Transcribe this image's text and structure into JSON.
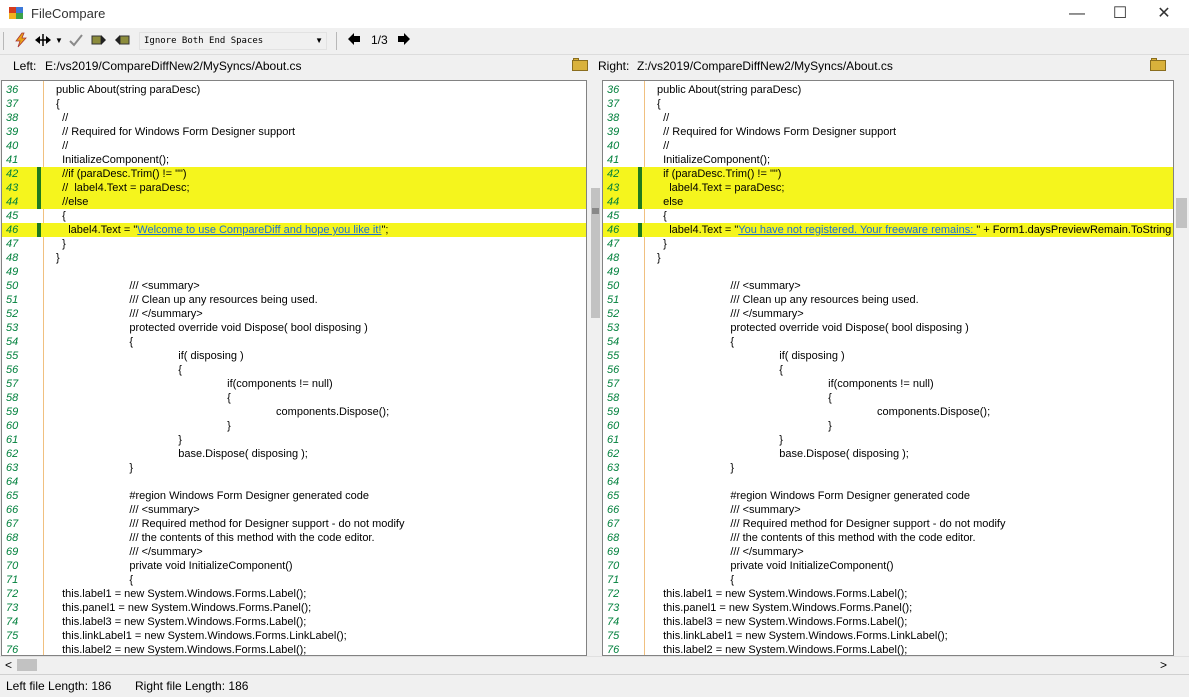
{
  "window": {
    "title": "FileCompare",
    "minimize_glyph": "—",
    "maximize_glyph": "☐",
    "close_glyph": "✕"
  },
  "toolbar": {
    "ignore_option": "Ignore Both End Spaces",
    "page_indicator": "1/3",
    "icons": [
      "lightning-icon",
      "split-arrows-icon",
      "dropdown-arrow-icon",
      "check-icon",
      "copy-right-icon",
      "copy-left-icon",
      "prev-arrow-icon",
      "next-arrow-icon"
    ]
  },
  "left": {
    "label": "Left:",
    "path": "E:/vs2019/CompareDiffNew2/MySyncs/About.cs",
    "lines": [
      {
        "n": "36",
        "t": "public About(string paraDesc)"
      },
      {
        "n": "37",
        "t": "{"
      },
      {
        "n": "38",
        "t": "  //"
      },
      {
        "n": "39",
        "t": "  // Required for Windows Form Designer support"
      },
      {
        "n": "40",
        "t": "  //"
      },
      {
        "n": "41",
        "t": "  InitializeComponent();"
      },
      {
        "n": "42",
        "t": "  //if (paraDesc.Trim() != \"\")"
      },
      {
        "n": "43",
        "t": "  //  label4.Text = paraDesc;"
      },
      {
        "n": "44",
        "t": "  //else"
      },
      {
        "n": "45",
        "t": "  {"
      },
      {
        "n": "46",
        "t": "    label4.Text = \"Welcome to use CompareDiff and hope you like it!\";"
      },
      {
        "n": "47",
        "t": "  }"
      },
      {
        "n": "48",
        "t": "}"
      },
      {
        "n": "49",
        "t": ""
      },
      {
        "n": "50",
        "t": "                        /// <summary>"
      },
      {
        "n": "51",
        "t": "                        /// Clean up any resources being used."
      },
      {
        "n": "52",
        "t": "                        /// </summary>"
      },
      {
        "n": "53",
        "t": "                        protected override void Dispose( bool disposing )"
      },
      {
        "n": "54",
        "t": "                        {"
      },
      {
        "n": "55",
        "t": "                                        if( disposing )"
      },
      {
        "n": "56",
        "t": "                                        {"
      },
      {
        "n": "57",
        "t": "                                                        if(components != null)"
      },
      {
        "n": "58",
        "t": "                                                        {"
      },
      {
        "n": "59",
        "t": "                                                                        components.Dispose();"
      },
      {
        "n": "60",
        "t": "                                                        }"
      },
      {
        "n": "61",
        "t": "                                        }"
      },
      {
        "n": "62",
        "t": "                                        base.Dispose( disposing );"
      },
      {
        "n": "63",
        "t": "                        }"
      },
      {
        "n": "64",
        "t": ""
      },
      {
        "n": "65",
        "t": "                        #region Windows Form Designer generated code"
      },
      {
        "n": "66",
        "t": "                        /// <summary>"
      },
      {
        "n": "67",
        "t": "                        /// Required method for Designer support - do not modify"
      },
      {
        "n": "68",
        "t": "                        /// the contents of this method with the code editor."
      },
      {
        "n": "69",
        "t": "                        /// </summary>"
      },
      {
        "n": "70",
        "t": "                        private void InitializeComponent()"
      },
      {
        "n": "71",
        "t": "                        {"
      },
      {
        "n": "72",
        "t": "  this.label1 = new System.Windows.Forms.Label();"
      },
      {
        "n": "73",
        "t": "  this.panel1 = new System.Windows.Forms.Panel();"
      },
      {
        "n": "74",
        "t": "  this.label3 = new System.Windows.Forms.Label();"
      },
      {
        "n": "75",
        "t": "  this.linkLabel1 = new System.Windows.Forms.LinkLabel();"
      },
      {
        "n": "76",
        "t": "  this.label2 = new System.Windows.Forms.Label();"
      }
    ]
  },
  "right": {
    "label": "Right:",
    "path": "Z:/vs2019/CompareDiffNew2/MySyncs/About.cs",
    "lines": [
      {
        "n": "36",
        "t": "public About(string paraDesc)"
      },
      {
        "n": "37",
        "t": "{"
      },
      {
        "n": "38",
        "t": "  //"
      },
      {
        "n": "39",
        "t": "  // Required for Windows Form Designer support"
      },
      {
        "n": "40",
        "t": "  //"
      },
      {
        "n": "41",
        "t": "  InitializeComponent();"
      },
      {
        "n": "42",
        "t": "  if (paraDesc.Trim() != \"\")"
      },
      {
        "n": "43",
        "t": "    label4.Text = paraDesc;"
      },
      {
        "n": "44",
        "t": "  else"
      },
      {
        "n": "45",
        "t": "  {"
      },
      {
        "n": "46",
        "t": "    label4.Text = \"You have not registered. Your freeware remains: \" + Form1.daysPreviewRemain.ToString"
      },
      {
        "n": "47",
        "t": "  }"
      },
      {
        "n": "48",
        "t": "}"
      },
      {
        "n": "49",
        "t": ""
      },
      {
        "n": "50",
        "t": "                        /// <summary>"
      },
      {
        "n": "51",
        "t": "                        /// Clean up any resources being used."
      },
      {
        "n": "52",
        "t": "                        /// </summary>"
      },
      {
        "n": "53",
        "t": "                        protected override void Dispose( bool disposing )"
      },
      {
        "n": "54",
        "t": "                        {"
      },
      {
        "n": "55",
        "t": "                                        if( disposing )"
      },
      {
        "n": "56",
        "t": "                                        {"
      },
      {
        "n": "57",
        "t": "                                                        if(components != null)"
      },
      {
        "n": "58",
        "t": "                                                        {"
      },
      {
        "n": "59",
        "t": "                                                                        components.Dispose();"
      },
      {
        "n": "60",
        "t": "                                                        }"
      },
      {
        "n": "61",
        "t": "                                        }"
      },
      {
        "n": "62",
        "t": "                                        base.Dispose( disposing );"
      },
      {
        "n": "63",
        "t": "                        }"
      },
      {
        "n": "64",
        "t": ""
      },
      {
        "n": "65",
        "t": "                        #region Windows Form Designer generated code"
      },
      {
        "n": "66",
        "t": "                        /// <summary>"
      },
      {
        "n": "67",
        "t": "                        /// Required method for Designer support - do not modify"
      },
      {
        "n": "68",
        "t": "                        /// the contents of this method with the code editor."
      },
      {
        "n": "69",
        "t": "                        /// </summary>"
      },
      {
        "n": "70",
        "t": "                        private void InitializeComponent()"
      },
      {
        "n": "71",
        "t": "                        {"
      },
      {
        "n": "72",
        "t": "  this.label1 = new System.Windows.Forms.Label();"
      },
      {
        "n": "73",
        "t": "  this.panel1 = new System.Windows.Forms.Panel();"
      },
      {
        "n": "74",
        "t": "  this.label3 = new System.Windows.Forms.Label();"
      },
      {
        "n": "75",
        "t": "  this.linkLabel1 = new System.Windows.Forms.LinkLabel();"
      },
      {
        "n": "76",
        "t": "  this.label2 = new System.Windows.Forms.Label();"
      }
    ]
  },
  "diff": {
    "changed_lines": [
      42,
      43,
      44,
      46
    ],
    "highlight_color": "#f5f51d",
    "marker_color": "#1e7a1e",
    "line_number_color": "#00803c",
    "link_color": "#1a6fd6"
  },
  "status": {
    "left_length": "Left file Length: 186",
    "right_length": "Right file Length: 186"
  },
  "scrollbars": {
    "left_arrow": "<",
    "right_arrow": ">"
  }
}
